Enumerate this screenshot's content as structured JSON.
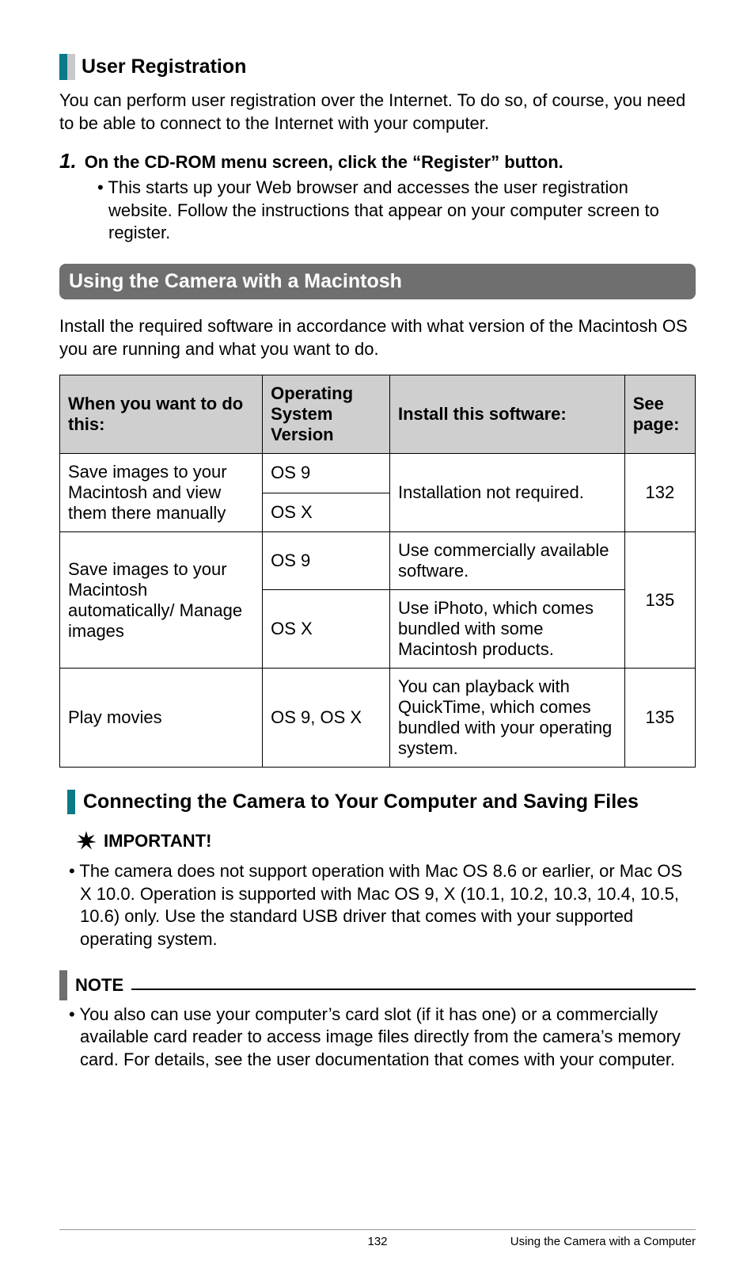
{
  "section1": {
    "title": "User Registration",
    "intro": "You can perform user registration over the Internet. To do so, of course, you need to be able to connect to the Internet with your computer.",
    "step_num": "1.",
    "step_text": "On the CD-ROM menu screen, click the “Register” button.",
    "step_bullet": "• This starts up your Web browser and accesses the user registration website. Follow the instructions that appear on your computer screen to register."
  },
  "banner": "Using the Camera with a Macintosh",
  "banner_intro": "Install the required software in accordance with what version of the Macintosh OS you are running and what you want to do.",
  "table": {
    "headers": [
      "When you want to do this:",
      "Operating System Version",
      "Install this software:",
      "See page:"
    ],
    "rows": {
      "r1_task": "Save images to your Macintosh and view them there manually",
      "r1_os_a": "OS 9",
      "r1_os_b": "OS X",
      "r1_install": "Installation not required.",
      "r1_page": "132",
      "r2_task": "Save images to your Macintosh automatically/\nManage images",
      "r2_os_a": "OS 9",
      "r2_install_a": "Use commercially available software.",
      "r2_os_b": "OS X",
      "r2_install_b": "Use iPhoto, which comes bundled with some Macintosh products.",
      "r2_page": "135",
      "r3_task": "Play movies",
      "r3_os": "OS 9, OS X",
      "r3_install": "You can playback with QuickTime, which comes bundled with your operating system.",
      "r3_page": "135"
    }
  },
  "subsection": {
    "title": "Connecting the Camera to Your Computer and Saving Files"
  },
  "important": {
    "label": "IMPORTANT!",
    "bullet": "• The camera does not support operation with Mac OS 8.6 or earlier, or Mac OS X 10.0. Operation is supported with Mac OS 9, X (10.1, 10.2, 10.3, 10.4, 10.5, 10.6) only. Use the standard USB driver that comes with your supported operating system."
  },
  "note": {
    "label": "NOTE",
    "bullet": "• You also can use your computer’s card slot (if it has one) or a commercially available card reader to access image files directly from the camera’s memory card. For details, see the user documentation that comes with your computer."
  },
  "footer": {
    "page_num": "132",
    "caption": "Using the Camera with a Computer"
  }
}
